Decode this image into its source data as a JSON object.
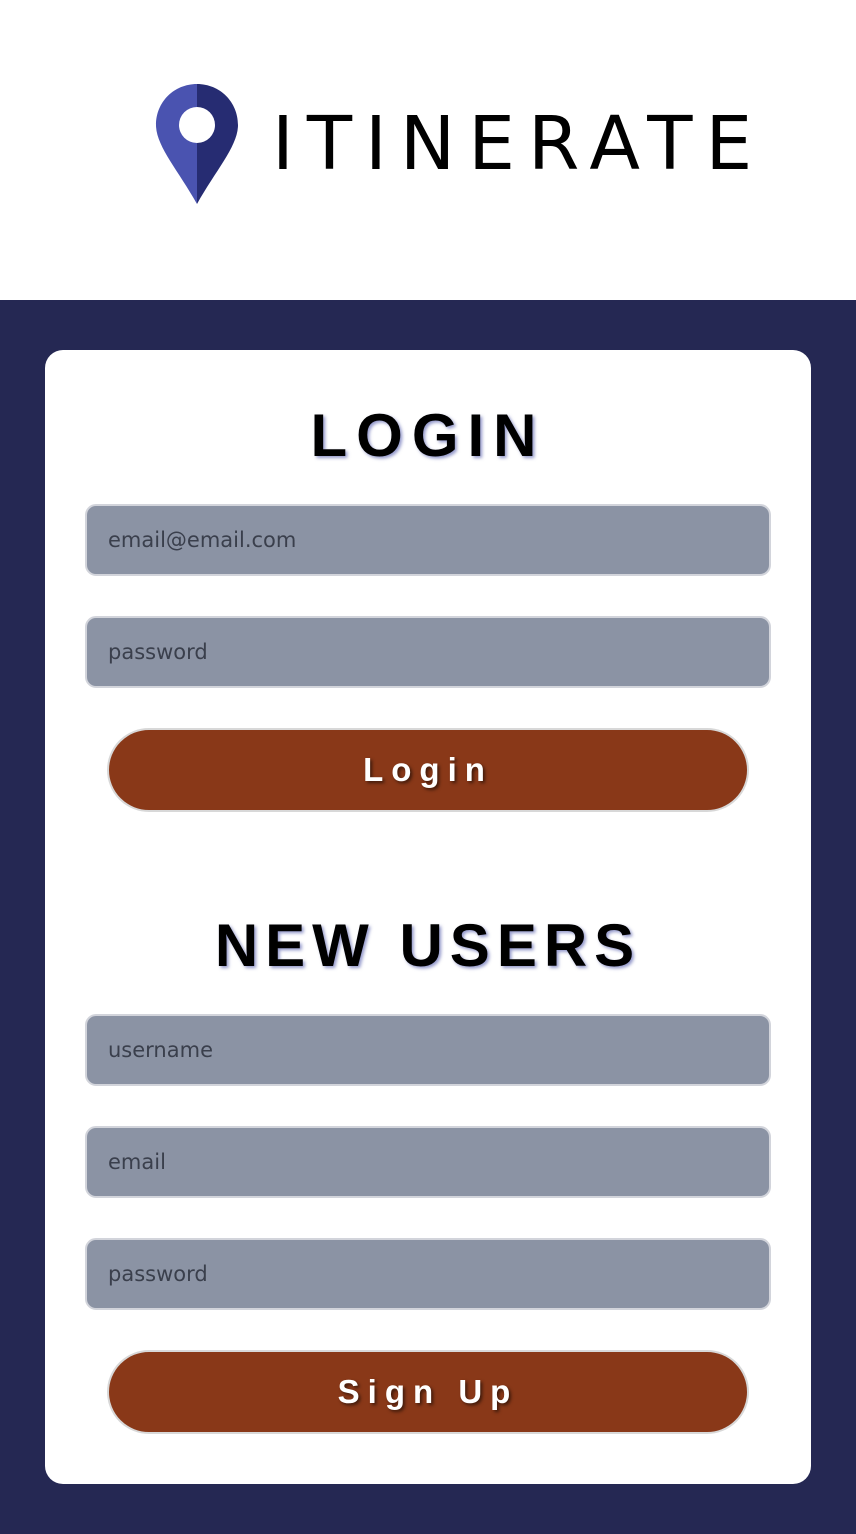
{
  "brand": {
    "name": "ITINERATE",
    "icon": "location-pin-icon",
    "colors": {
      "pin_light": "#4a53b0",
      "pin_dark": "#262c72"
    }
  },
  "colors": {
    "page_background": "#252853",
    "card_background": "#ffffff",
    "input_background": "#8b93a4",
    "button_background": "#893818",
    "button_text": "#ffffff"
  },
  "login": {
    "title": "LOGIN",
    "email_placeholder": "email@email.com",
    "password_placeholder": "password",
    "button_label": "Login"
  },
  "signup": {
    "title": "NEW USERS",
    "username_placeholder": "username",
    "email_placeholder": "email",
    "password_placeholder": "password",
    "button_label": "Sign Up"
  }
}
